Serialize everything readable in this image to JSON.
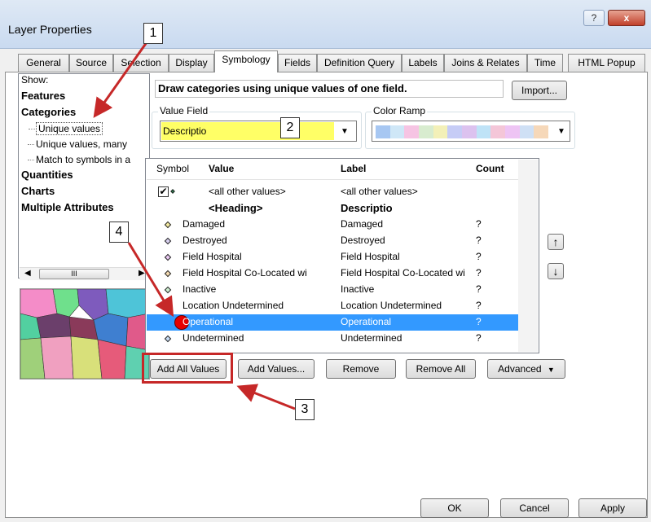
{
  "window": {
    "title": "Layer Properties",
    "help_label": "?",
    "close_label": "x"
  },
  "tabs": [
    {
      "label": "General"
    },
    {
      "label": "Source"
    },
    {
      "label": "Selection"
    },
    {
      "label": "Display"
    },
    {
      "label": "Symbology"
    },
    {
      "label": "Fields"
    },
    {
      "label": "Definition Query"
    },
    {
      "label": "Labels"
    },
    {
      "label": "Joins & Relates"
    },
    {
      "label": "Time"
    },
    {
      "label": "HTML Popup"
    }
  ],
  "show": {
    "label": "Show:",
    "features": "Features",
    "categories": "Categories",
    "unique_values": "Unique values",
    "unique_values_many": "Unique values, many",
    "match_symbols": "Match to symbols in a",
    "quantities": "Quantities",
    "charts": "Charts",
    "multiple_attributes": "Multiple Attributes",
    "scroll_thumb": "III"
  },
  "main": {
    "description": "Draw categories using unique values of one field.",
    "import_label": "Import...",
    "value_field_label": "Value Field",
    "value_field_value": "Descriptio",
    "color_ramp_label": "Color Ramp",
    "color_ramp_colors": [
      "#a7c7f2",
      "#cfe7f7",
      "#f6c4e3",
      "#d8eccf",
      "#f3f0b8",
      "#c6ccf6",
      "#dcc2ef",
      "#bfe3f7",
      "#f4c6d8",
      "#eec4f4",
      "#cfe0f5",
      "#f6d8b9"
    ]
  },
  "table": {
    "headers": {
      "symbol": "Symbol",
      "value": "Value",
      "label": "Label",
      "count": "Count"
    },
    "rows": [
      {
        "value": "<all other values>",
        "label": "<all other values>",
        "count": "",
        "symbol": "check",
        "color": "#2e8b57"
      },
      {
        "value": "<Heading>",
        "label": "Descriptio",
        "count": "",
        "symbol": "none",
        "color": ""
      },
      {
        "value": "Damaged",
        "label": "Damaged",
        "count": "?",
        "symbol": "diamond",
        "color": "#f2e9a0"
      },
      {
        "value": "Destroyed",
        "label": "Destroyed",
        "count": "?",
        "symbol": "diamond",
        "color": "#d8d0f0"
      },
      {
        "value": "Field Hospital",
        "label": "Field Hospital",
        "count": "?",
        "symbol": "diamond",
        "color": "#e8c8f0"
      },
      {
        "value": "Field Hospital Co-Located wi",
        "label": "Field Hospital Co-Located wi",
        "count": "?",
        "symbol": "diamond",
        "color": "#f3d9b0"
      },
      {
        "value": "Inactive",
        "label": "Inactive",
        "count": "?",
        "symbol": "diamond",
        "color": "#cdeed0"
      },
      {
        "value": "Location Undetermined",
        "label": "Location Undetermined",
        "count": "?",
        "symbol": "diamond",
        "color": "#f7d6d6"
      },
      {
        "value": "Operational",
        "label": "Operational",
        "count": "?",
        "symbol": "circle",
        "color": "#e60000"
      },
      {
        "value": "Undetermined",
        "label": "Undetermined",
        "count": "?",
        "symbol": "diamond",
        "color": "#c8dcf5"
      }
    ]
  },
  "buttons": {
    "add_all": "Add All Values",
    "add_values": "Add Values...",
    "remove": "Remove",
    "remove_all": "Remove All",
    "advanced": "Advanced",
    "ok": "OK",
    "cancel": "Cancel",
    "apply": "Apply",
    "up": "↑",
    "down": "↓"
  },
  "callouts": [
    "1",
    "2",
    "3",
    "4"
  ],
  "colors": {
    "annotation_red": "#c62828",
    "selection_blue": "#3399ff"
  }
}
